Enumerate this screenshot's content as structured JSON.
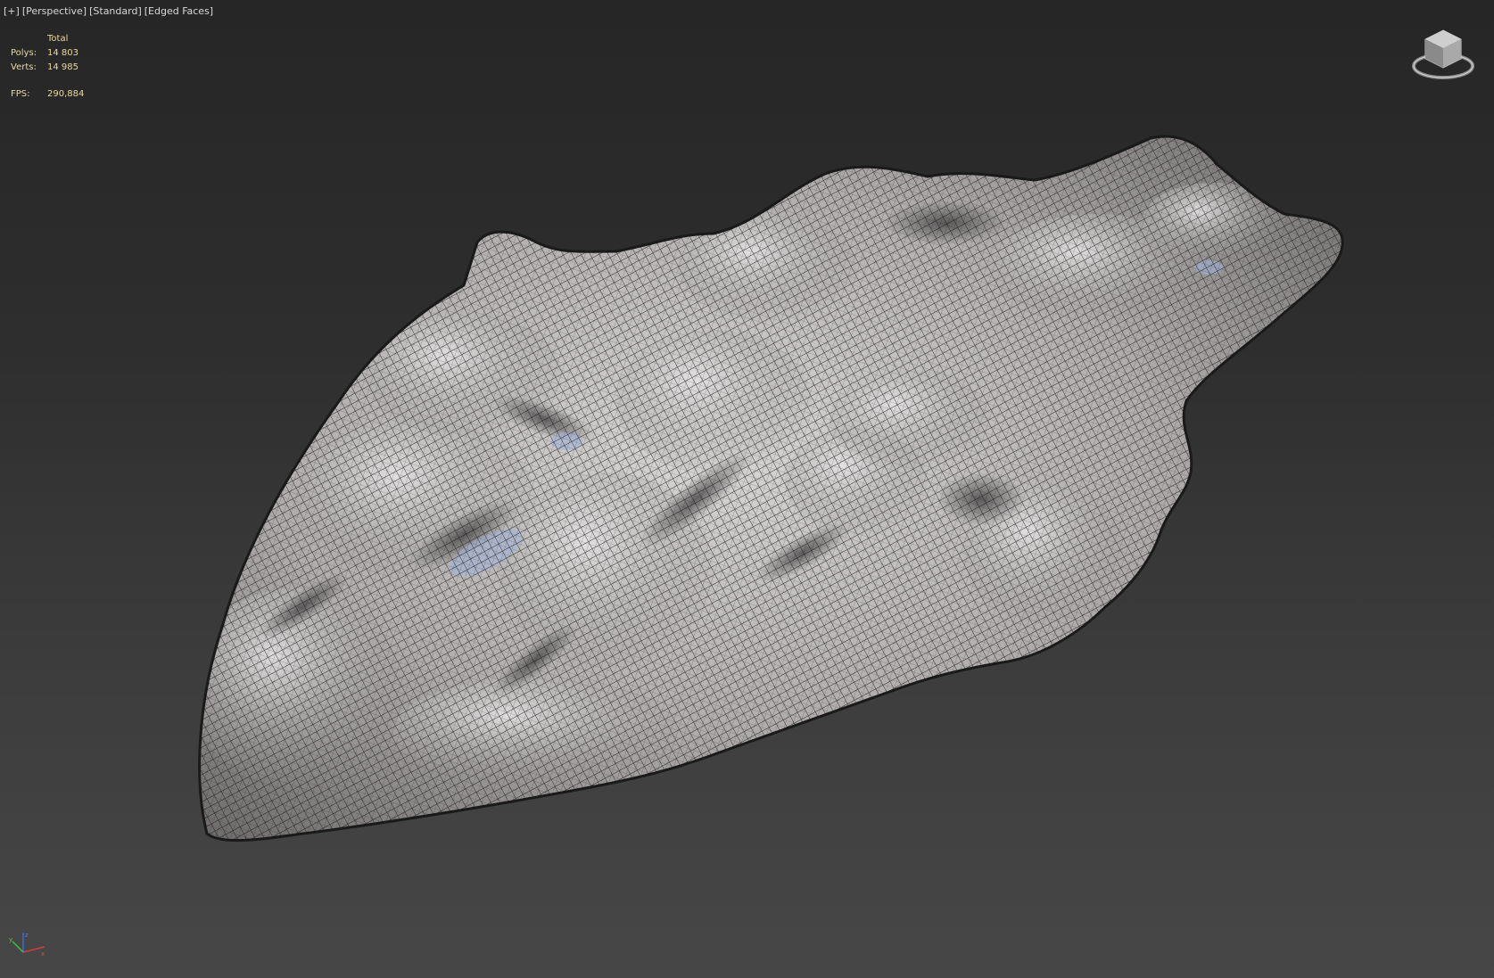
{
  "viewport": {
    "label_parts": [
      "[+]",
      "[Perspective]",
      "[Standard]",
      "[Edged Faces]"
    ],
    "label_separator": " "
  },
  "stats": {
    "header": "Total",
    "polys_label": "Polys:",
    "polys_value": "14 803",
    "verts_label": "Verts:",
    "verts_value": "14 985",
    "fps_label": "FPS:",
    "fps_value": "290,884"
  },
  "colors": {
    "stats_text": "#e8d9a0",
    "label_text": "#d8d8d8",
    "mesh_fill": "#a9a6a6",
    "mesh_edge": "#111111",
    "background_top": "#262626",
    "background_bottom": "#474747"
  },
  "icons": {
    "viewcube": "viewcube-icon",
    "axis": "axis-tripod-icon"
  }
}
